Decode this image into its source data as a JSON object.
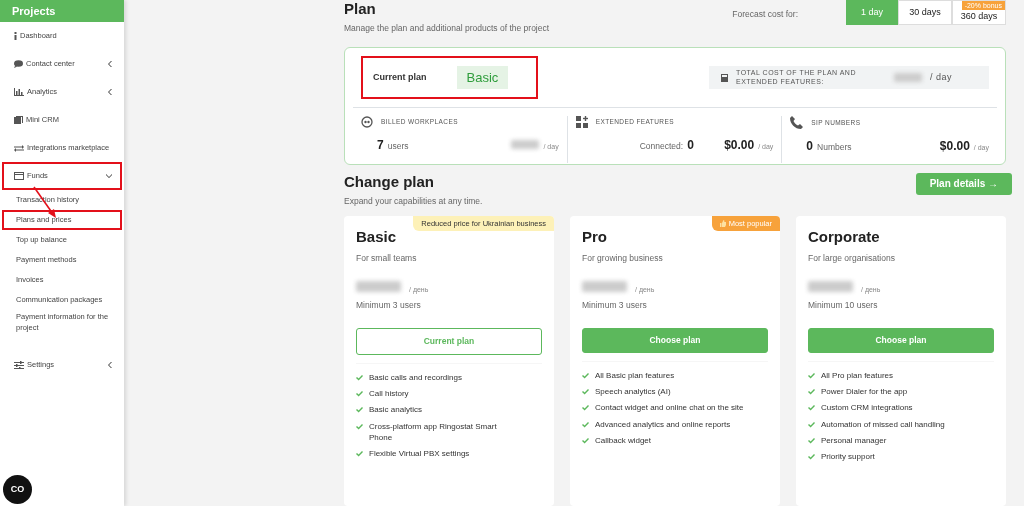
{
  "sidebar": {
    "header": "Projects",
    "items": [
      {
        "kind": "section",
        "label": "Dashboard",
        "highlighted": false
      },
      {
        "kind": "section",
        "label": "Contact center",
        "expanded": false,
        "highlighted": false
      },
      {
        "kind": "section",
        "label": "Analytics",
        "expanded": false,
        "highlighted": false
      },
      {
        "kind": "section",
        "label": "Mini CRM",
        "highlighted": false
      },
      {
        "kind": "section",
        "label": "Integrations marketplace",
        "highlighted": false
      },
      {
        "kind": "section",
        "label": "Funds",
        "expanded": true,
        "highlighted": true
      },
      {
        "kind": "subitem",
        "label": "Transaction history",
        "highlighted": false
      },
      {
        "kind": "subitem",
        "label": "Plans and prices",
        "highlighted": true
      },
      {
        "kind": "subitem",
        "label": "Top up balance",
        "highlighted": false
      },
      {
        "kind": "subitem",
        "label": "Payment methods",
        "highlighted": false
      },
      {
        "kind": "subitem",
        "label": "Invoices",
        "highlighted": false
      },
      {
        "kind": "subitem",
        "label": "Communication packages",
        "highlighted": false
      },
      {
        "kind": "subitem",
        "label": "Payment information for the project",
        "highlighted": false
      },
      {
        "kind": "section",
        "label": "Settings",
        "expanded": false,
        "highlighted": false
      }
    ],
    "chat_widget": "CO"
  },
  "plan": {
    "title": "Plan",
    "subtitle": "Manage the plan and additional products of the project",
    "forecast": {
      "label": "Forecast cost for:",
      "options": [
        {
          "label": "1 day",
          "selected": true
        },
        {
          "label": "30 days",
          "selected": false
        },
        {
          "label": "360 days",
          "selected": false,
          "badge": "-20% bonus"
        }
      ]
    },
    "current_plan_label": "Current plan",
    "current_plan": "Basic",
    "highlighted": true,
    "total_label": "TOTAL COST OF THE PLAN AND EXTENDED FEATURES:",
    "total_unit": "/ day",
    "metrics": [
      {
        "title": "BILLED WORKPLACES",
        "value": "7",
        "unit": "users",
        "price_unit": "/ day"
      },
      {
        "title": "EXTENDED FEATURES",
        "prefix": "Connected:",
        "value": "0",
        "price": "$0.00",
        "price_unit": "/ day"
      },
      {
        "title": "SIP NUMBERS",
        "value": "0",
        "unit": "Numbers",
        "price": "$0.00",
        "price_unit": "/ day"
      }
    ]
  },
  "change_plan": {
    "title": "Change plan",
    "subtitle": "Expand your capabilities at any time.",
    "details_button": "Plan details →",
    "plans": [
      {
        "name": "Basic",
        "tagline": "For small teams",
        "price_unit": "/ день",
        "minimum": "Minimum 3 users",
        "badge": {
          "kind": "note",
          "text": "Reduced price for Ukrainian business"
        },
        "button": {
          "label": "Current plan",
          "current": true
        },
        "features": [
          "Basic calls and recordings",
          "Call history",
          "Basic analytics",
          "Cross-platform app Ringostat Smart Phone",
          "Flexible Virtual PBX settings"
        ]
      },
      {
        "name": "Pro",
        "tagline": "For growing business",
        "price_unit": "/ день",
        "minimum": "Minimum 3 users",
        "badge": {
          "kind": "popular",
          "text": "Most popular"
        },
        "button": {
          "label": "Choose plan",
          "current": false
        },
        "features": [
          "All Basic plan features",
          "Speech analytics (AI)",
          "Contact widget and online chat on the site",
          "Advanced analytics and online reports",
          "Callback widget"
        ]
      },
      {
        "name": "Corporate",
        "tagline": "For large organisations",
        "price_unit": "/ день",
        "minimum": "Minimum 10 users",
        "button": {
          "label": "Choose plan",
          "current": false
        },
        "features": [
          "All Pro plan features",
          "Power Dialer for the app",
          "Custom CRM integrations",
          "Automation of missed call handling",
          "Personal manager",
          "Priority support"
        ]
      }
    ]
  }
}
